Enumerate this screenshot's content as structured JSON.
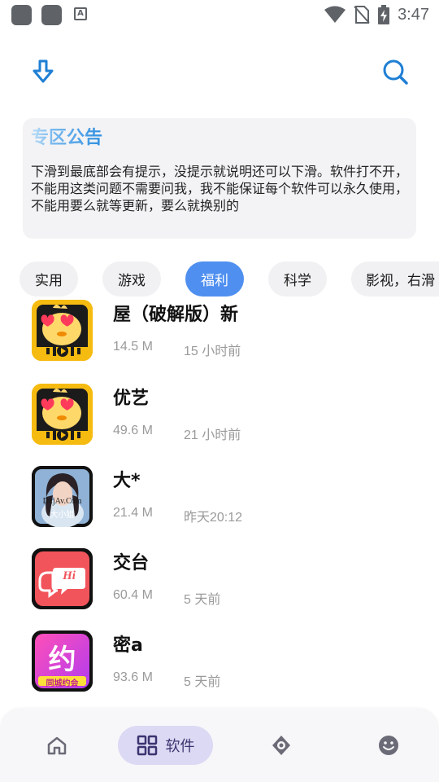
{
  "status_bar": {
    "time": "3:47",
    "a_badge": "A"
  },
  "colors": {
    "accent": "#1f7fd4",
    "chip_active": "#4f8ff0",
    "nav_pill": "#dcd9f4"
  },
  "notice": {
    "title": "专区公告",
    "body": "下滑到最底部会有提示，没提示就说明还可以下滑。软件打不开，不能用这类问题不需要问我，我不能保证每个软件可以永久使用，不能用要么就等更新，要么就换别的"
  },
  "categories": [
    {
      "label": "实用",
      "active": false
    },
    {
      "label": "游戏",
      "active": false
    },
    {
      "label": "福利",
      "active": true
    },
    {
      "label": "科学",
      "active": false
    },
    {
      "label": "影视，右滑",
      "active": false
    }
  ],
  "apps": [
    {
      "name": "屋（破解版）新",
      "size": "14.5 M",
      "time": "15 小时前",
      "icon": "chick-app-icon"
    },
    {
      "name": "优艺",
      "size": "49.6 M",
      "time": "21 小时前",
      "icon": "chick-app-icon"
    },
    {
      "name": "大*",
      "size": "21.4 M",
      "time": "昨天20:12",
      "icon": "portrait-app-icon",
      "icon_text": "DxjAv.Com",
      "icon_subtext": "大小姐"
    },
    {
      "name": "交台",
      "size": "60.4 M",
      "time": "5 天前",
      "icon": "hi-chat-app-icon",
      "icon_text": "Hi"
    },
    {
      "name": "密a",
      "size": "93.6 M",
      "time": "5 天前",
      "icon": "date-app-icon",
      "icon_text": "约",
      "icon_subtext": "同城约会"
    }
  ],
  "bottom_nav": {
    "items": [
      {
        "name": "home",
        "icon": "home-icon",
        "label": ""
      },
      {
        "name": "software",
        "icon": "grid-icon",
        "label": "软件",
        "active": true
      },
      {
        "name": "discover",
        "icon": "compass-icon",
        "label": ""
      },
      {
        "name": "profile",
        "icon": "smiley-icon",
        "label": ""
      }
    ]
  }
}
